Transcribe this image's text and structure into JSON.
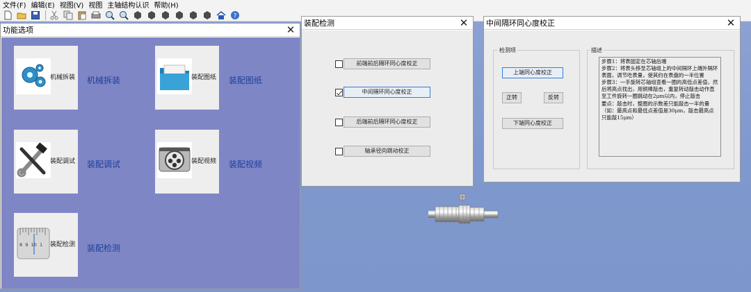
{
  "menu": {
    "items": [
      "文件(F)",
      "编辑(E)",
      "视图(V)",
      "视图",
      "主轴结构认识",
      "帮助(H)"
    ]
  },
  "toolbar": {
    "icons": [
      "new-icon",
      "open-icon",
      "save-icon",
      "cut-icon",
      "copy-icon",
      "paste-icon",
      "print-icon",
      "zoom-in-icon",
      "zoom-out-icon",
      "cube-icon",
      "cube-icon",
      "cube-icon",
      "cube-icon",
      "cube-icon",
      "cube-icon",
      "home-icon",
      "help-icon"
    ]
  },
  "func_window": {
    "title": "功能选项",
    "tiles": [
      {
        "label": "机械拆装",
        "caption": "机械拆装",
        "icon": "gears-icon"
      },
      {
        "label": "装配图纸",
        "caption": "装配图纸",
        "icon": "folder-icon"
      },
      {
        "label": "装配调试",
        "caption": "装配调试",
        "icon": "tools-icon"
      },
      {
        "label": "装配视频",
        "caption": "装配视频",
        "icon": "film-reel-icon"
      },
      {
        "label": "装配检测",
        "caption": "装配检测",
        "icon": "ruler-icon"
      }
    ],
    "ruler_digits": "8  9  10  1"
  },
  "detect_window": {
    "title": "装配检测",
    "options": [
      {
        "label": "前端前后隔环同心度校正",
        "checked": false
      },
      {
        "label": "中间隔环同心度校正",
        "checked": true
      },
      {
        "label": "后端前后隔环同心度校正",
        "checked": false
      },
      {
        "label": "轴承径向跳动校正",
        "checked": false
      }
    ]
  },
  "conc_window": {
    "title": "中间隔环同心度校正",
    "group_detect": "检测项",
    "group_desc": "描述",
    "btn_upper": "上端同心度校正",
    "btn_cw": "正转",
    "btn_ccw": "反转",
    "btn_lower": "下端同心度校正",
    "description": "步骤1：将表固定在芯轴后端\n步骤2：将表头移至芯轴组上的中间隔环上端外隔环表面，调节吃表量，使其约在表盘的一半位置\n步骤3：一手旋转芯轴组查看一圈的高低点差值，然后将高点找出，用铜棒敲击，重复转动敲击动作直至工件旋转一圈跳动在2μm以内，停止敲击\n要点：敲击时，整圈的示数差只能敲击一半的量（如：最高点和最低点差值是30μm，敲击最高点只能敲15μm）"
  },
  "colors": {
    "desktop": "#7f98cd",
    "panel": "#7f86c6",
    "caption": "#1e3f9a",
    "focus_border": "#2f7fd6"
  }
}
